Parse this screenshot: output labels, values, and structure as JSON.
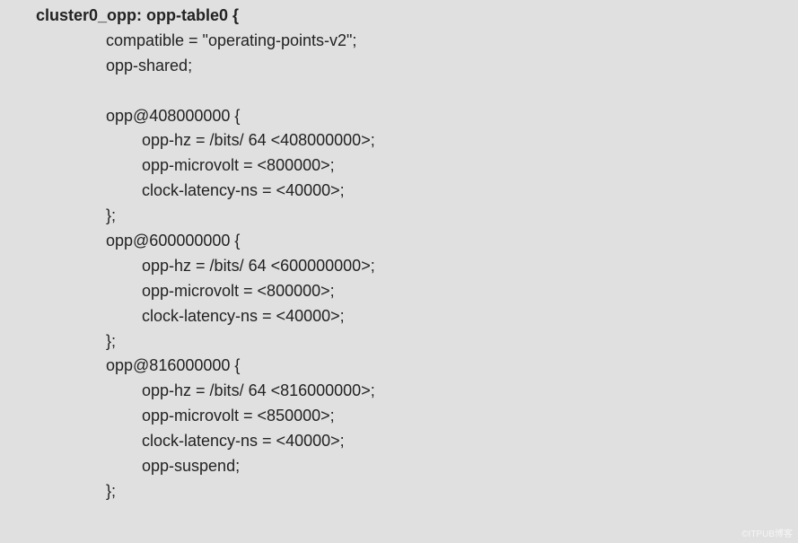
{
  "code": {
    "header": "cluster0_opp: opp-table0 {",
    "compatible": "compatible = \"operating-points-v2\";",
    "shared": "opp-shared;",
    "opp1_open": "opp@408000000 {",
    "opp1_hz": "opp-hz = /bits/ 64 <408000000>;",
    "opp1_uv": "opp-microvolt = <800000>;",
    "opp1_lat": "clock-latency-ns = <40000>;",
    "opp1_close": "};",
    "opp2_open": "opp@600000000 {",
    "opp2_hz": "opp-hz = /bits/ 64 <600000000>;",
    "opp2_uv": "opp-microvolt = <800000>;",
    "opp2_lat": "clock-latency-ns = <40000>;",
    "opp2_close": "};",
    "opp3_open": "opp@816000000 {",
    "opp3_hz": "opp-hz = /bits/ 64 <816000000>;",
    "opp3_uv": "opp-microvolt = <850000>;",
    "opp3_lat": "clock-latency-ns = <40000>;",
    "opp3_susp": "opp-suspend;",
    "opp3_close": "};"
  },
  "watermark": "©ITPUB博客"
}
